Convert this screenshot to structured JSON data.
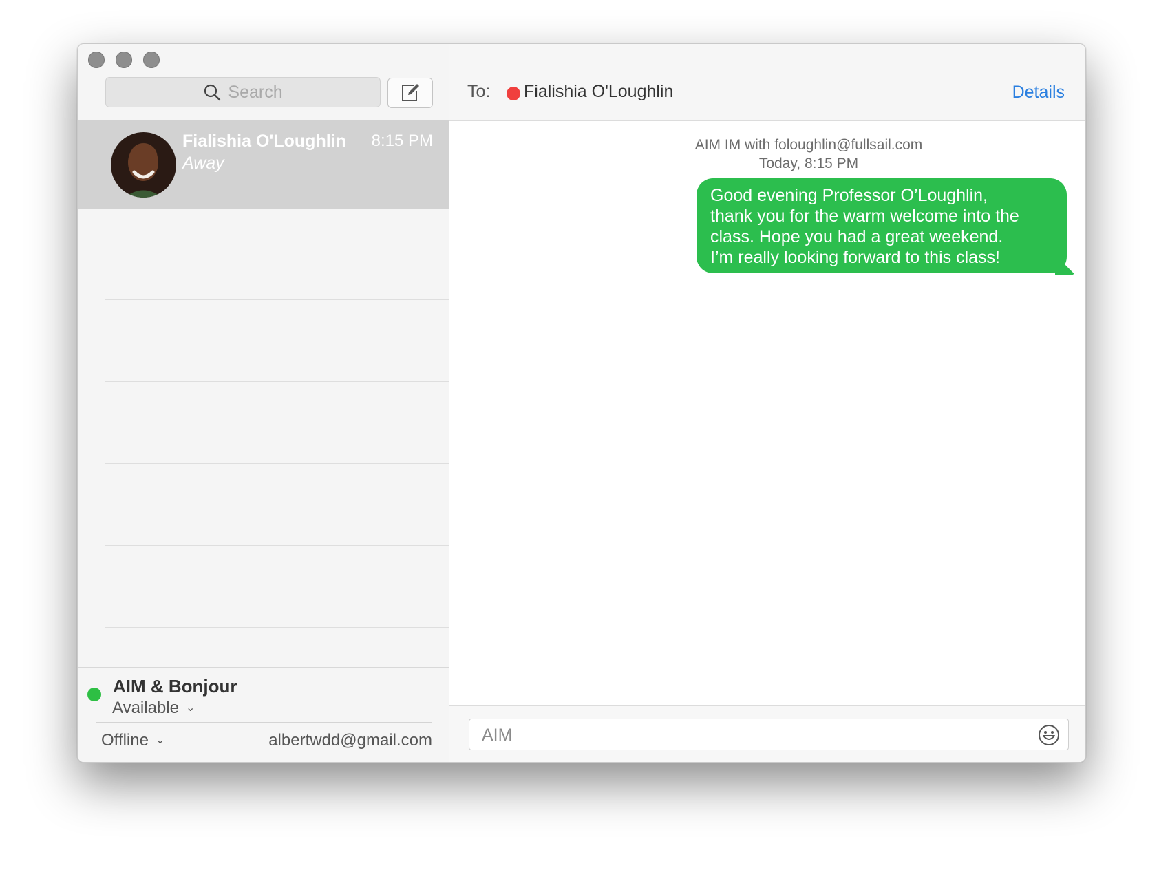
{
  "sidebar": {
    "search_placeholder": "Search",
    "conversations": [
      {
        "name": "Fialishia O'Loughlin",
        "time": "8:15 PM",
        "status": "Away",
        "avatar": "avatar-photo"
      }
    ],
    "account": {
      "name": "AIM & Bonjour",
      "status": "Available",
      "status_color": "#2ebf44",
      "alt_status": "Offline",
      "email": "albertwdd@gmail.com"
    }
  },
  "header": {
    "to_label": "To:",
    "recipient": "Fialishia O'Loughlin",
    "recipient_status_color": "#f0403e",
    "details_label": "Details"
  },
  "chat": {
    "meta_line": "AIM IM with foloughlin@fullsail.com",
    "timestamp": "Today, 8:15 PM",
    "messages": [
      {
        "direction": "outgoing",
        "lines": [
          "Good evening Professor O’Loughlin,",
          "thank you for the warm welcome into the",
          "class. Hope you had a great weekend.",
          "I’m really looking forward to this class!"
        ],
        "color": "#2cbe4e"
      }
    ]
  },
  "composer": {
    "placeholder": "AIM",
    "emoji_icon": "smiley-icon"
  },
  "colors": {
    "accent": "#2a7fe0",
    "selection": "#d2d2d2"
  }
}
